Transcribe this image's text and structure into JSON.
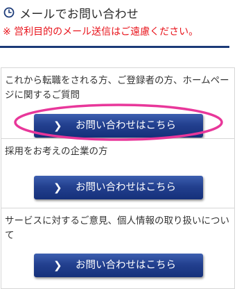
{
  "header": {
    "title": "メールでお問い合わせ",
    "notice": "※ 営利目的のメール送信はご遠慮ください。",
    "icon": "clock-icon",
    "rule_color": "#1b3a78"
  },
  "sections": [
    {
      "text": "これから転職をされる方、ご登録者の方、ホームページに関するご質問",
      "button_label": "お問い合わせはこちら",
      "button_icon": "chevron-right-icon",
      "highlighted": true
    },
    {
      "text": "採用をお考えの企業の方",
      "button_label": "お問い合わせはこちら",
      "button_icon": "chevron-right-icon",
      "highlighted": false
    },
    {
      "text": "サービスに対するご意見、個人情報の取り扱いについて",
      "button_label": "お問い合わせはこちら",
      "button_icon": "chevron-right-icon",
      "highlighted": false
    }
  ],
  "colors": {
    "notice": "#e8121a",
    "button": "#23408f",
    "highlight": "#e8379a"
  }
}
